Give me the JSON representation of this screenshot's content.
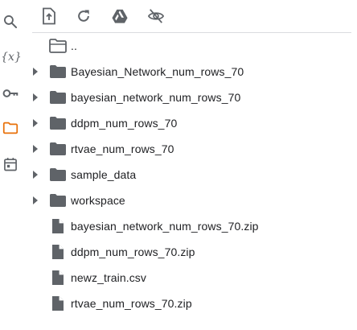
{
  "colors": {
    "icon": "#5f6368",
    "active": "#e8710a",
    "text": "#202124",
    "divider": "#dadce0"
  },
  "rail": {
    "variables_label": "{x}",
    "items": [
      {
        "icon": "search-icon"
      },
      {
        "icon": "variables-icon"
      },
      {
        "icon": "key-icon"
      },
      {
        "icon": "folder-icon",
        "active": true
      },
      {
        "icon": "calendar-icon"
      }
    ]
  },
  "toolbar": {
    "items": [
      {
        "icon": "upload-file-icon"
      },
      {
        "icon": "refresh-icon"
      },
      {
        "icon": "google-drive-icon"
      },
      {
        "icon": "hide-icon"
      }
    ]
  },
  "files": {
    "parent": "..",
    "items": [
      {
        "type": "folder",
        "name": "Bayesian_Network_num_rows_70"
      },
      {
        "type": "folder",
        "name": "bayesian_network_num_rows_70"
      },
      {
        "type": "folder",
        "name": "ddpm_num_rows_70"
      },
      {
        "type": "folder",
        "name": "rtvae_num_rows_70"
      },
      {
        "type": "folder",
        "name": "sample_data"
      },
      {
        "type": "folder",
        "name": "workspace"
      },
      {
        "type": "file",
        "name": "bayesian_network_num_rows_70.zip"
      },
      {
        "type": "file",
        "name": "ddpm_num_rows_70.zip"
      },
      {
        "type": "file",
        "name": "newz_train.csv"
      },
      {
        "type": "file",
        "name": "rtvae_num_rows_70.zip"
      }
    ]
  }
}
